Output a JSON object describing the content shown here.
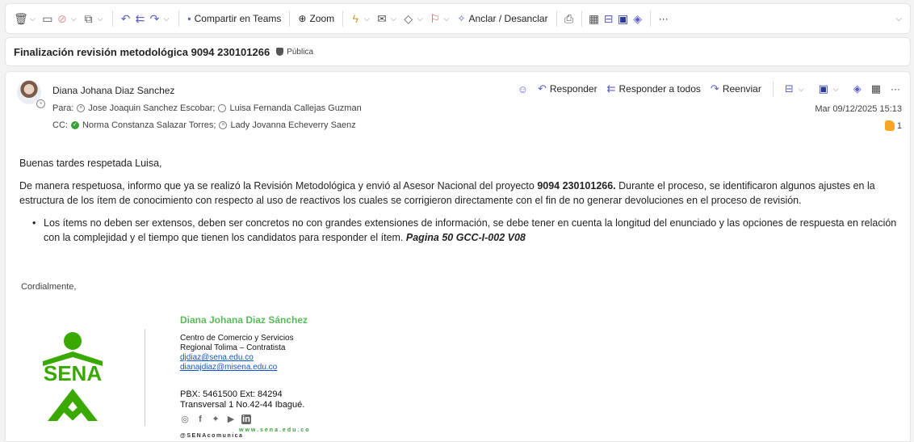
{
  "toolbar": {
    "teams_label": "Compartir en Teams",
    "zoom_label": "Zoom",
    "pin_label": "Anclar / Desanclar",
    "more_label": "···"
  },
  "subject": {
    "title": "Finalización revisión metodológica 9094 230101266",
    "badge": "Pública"
  },
  "message": {
    "sender": "Diana Johana Diaz Sanchez",
    "to_label": "Para:",
    "to": [
      "Jose Joaquin Sanchez Escobar;",
      "Luisa Fernanda Callejas Guzman"
    ],
    "cc_label": "CC:",
    "cc": [
      "Norma Constanza Salazar Torres;",
      "Lady Jovanna Echeverry Saenz"
    ],
    "date": "Mar 09/12/2025 15:13",
    "reaction_count": "1",
    "actions": {
      "reply": "Responder",
      "reply_all": "Responder a todos",
      "forward": "Reenviar",
      "more": "···"
    }
  },
  "body": {
    "greeting": "Buenas tardes respetada Luisa,",
    "p1_a": "De manera respetuosa, informo que ya se realizó la Revisión Metodológica y envió al Asesor Nacional del proyecto ",
    "p1_bold": "9094 230101266.",
    "p1_b": " Durante el proceso, se identificaron algunos ajustes en la estructura de los ítem de conocimiento con respecto al uso de reactivos los cuales se corrigieron directamente con el fin de no generar devoluciones en el proceso de revisión.",
    "bullet_text": "Los ítems no deben ser extensos, deben ser concretos no con grandes extensiones de información, se debe tener en cuenta la longitud del enunciado y las opciones de respuesta en relación con la complejidad y el tiempo que tienen los candidatos para responder el ítem. ",
    "bullet_ref": "Pagina 50 GCC-I-002 V08",
    "closing": "Cordialmente,"
  },
  "signature": {
    "name": "Diana Johana Diaz Sánchez",
    "line1": "Centro de Comercio y Servicios",
    "line2": "Regional Tolima – Contratista",
    "email1": "djdiaz@sena.edu.co",
    "email2": "dianajdiaz@misena.edu.co",
    "pbx": "PBX: 5461500 Ext: 84294",
    "address": "Transversal 1 No.42-44 Ibagué.",
    "web": "www.sena.edu.co",
    "handle": "@SENAcomunica",
    "logo_text": "SENA"
  },
  "colors": {
    "accent": "#5b5fc7",
    "sena_green": "#39a900",
    "link": "#1155cc"
  }
}
